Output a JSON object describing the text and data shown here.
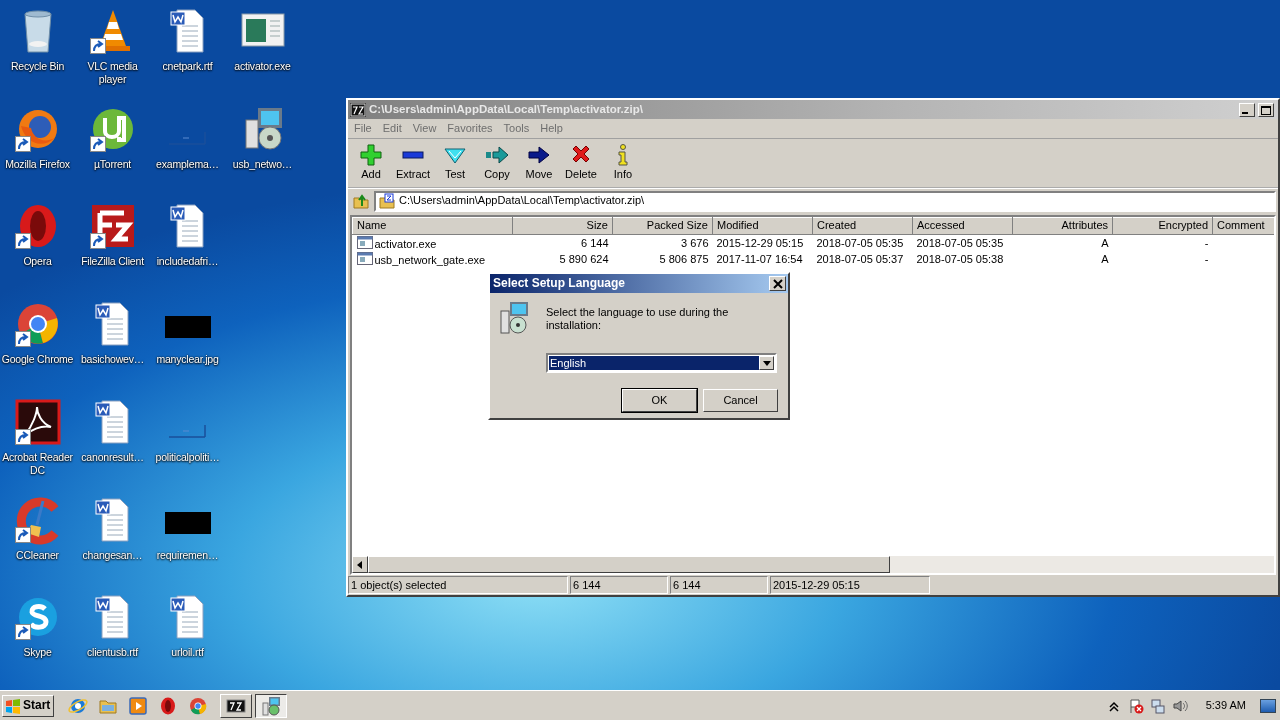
{
  "desktop": {
    "columns": [
      [
        {
          "label": "Recycle Bin",
          "kind": "recycle",
          "shortcut": false
        },
        {
          "label": "Mozilla Firefox",
          "kind": "firefox",
          "shortcut": true
        },
        {
          "label": "Opera",
          "kind": "opera",
          "shortcut": true
        },
        {
          "label": "Google Chrome",
          "kind": "chrome",
          "shortcut": true
        },
        {
          "label": "Acrobat Reader DC",
          "kind": "acrobat",
          "shortcut": true
        },
        {
          "label": "CCleaner",
          "kind": "ccleaner",
          "shortcut": true
        },
        {
          "label": "Skype",
          "kind": "skype",
          "shortcut": true
        }
      ],
      [
        {
          "label": "VLC media player",
          "kind": "vlc",
          "shortcut": true
        },
        {
          "label": "µTorrent",
          "kind": "utorrent",
          "shortcut": true
        },
        {
          "label": "FileZilla Client",
          "kind": "filezilla",
          "shortcut": true
        },
        {
          "label": "basichowev…",
          "kind": "word",
          "shortcut": false
        },
        {
          "label": "canonresult…",
          "kind": "word",
          "shortcut": false
        },
        {
          "label": "changesan…",
          "kind": "word",
          "shortcut": false
        },
        {
          "label": "clientusb.rtf",
          "kind": "word",
          "shortcut": false
        }
      ],
      [
        {
          "label": "cnetpark.rtf",
          "kind": "word",
          "shortcut": false
        },
        {
          "label": "examplema…",
          "kind": "blank",
          "shortcut": false
        },
        {
          "label": "includedafri…",
          "kind": "word",
          "shortcut": false
        },
        {
          "label": "manyclear.jpg",
          "kind": "image",
          "shortcut": false
        },
        {
          "label": "politicalpoliti…",
          "kind": "blank",
          "shortcut": false
        },
        {
          "label": "requiremen…",
          "kind": "image",
          "shortcut": false
        },
        {
          "label": "urloil.rtf",
          "kind": "word",
          "shortcut": false
        }
      ],
      [
        {
          "label": "activator.exe",
          "kind": "exe",
          "shortcut": false
        },
        {
          "label": "usb_netwo…",
          "kind": "setup",
          "shortcut": false
        }
      ]
    ]
  },
  "archiver": {
    "title": "C:\\Users\\admin\\AppData\\Local\\Temp\\activator.zip\\",
    "menu": [
      "File",
      "Edit",
      "View",
      "Favorites",
      "Tools",
      "Help"
    ],
    "toolbar": [
      {
        "label": "Add",
        "kind": "add"
      },
      {
        "label": "Extract",
        "kind": "extract"
      },
      {
        "label": "Test",
        "kind": "test"
      },
      {
        "label": "Copy",
        "kind": "copy"
      },
      {
        "label": "Move",
        "kind": "move"
      },
      {
        "label": "Delete",
        "kind": "delete"
      },
      {
        "label": "Info",
        "kind": "info"
      }
    ],
    "path": "C:\\Users\\admin\\AppData\\Local\\Temp\\activator.zip\\",
    "columns": [
      "Name",
      "Size",
      "Packed Size",
      "Modified",
      "Created",
      "Accessed",
      "Attributes",
      "Encrypted",
      "Comment"
    ],
    "rows": [
      [
        "activator.exe",
        "6 144",
        "3 676",
        "2015-12-29 05:15",
        "2018-07-05 05:35",
        "2018-07-05 05:35",
        "A",
        "-"
      ],
      [
        "usb_network_gate.exe",
        "5 890 624",
        "5 806 875",
        "2017-11-07 16:54",
        "2018-07-05 05:37",
        "2018-07-05 05:38",
        "A",
        "-"
      ]
    ],
    "status_bar": [
      "1 object(s) selected",
      "6 144",
      "6 144",
      "2015-12-29 05:15"
    ]
  },
  "dialog": {
    "title": "Select Setup Language",
    "message": "Select the language to use during the installation:",
    "language": "English",
    "buttons": [
      {
        "label": "OK",
        "default": true
      },
      {
        "label": "Cancel",
        "default": false
      }
    ]
  },
  "taskbar": {
    "start": "Start",
    "pinned": [
      {
        "kind": "ie"
      },
      {
        "kind": "explorer"
      },
      {
        "kind": "media"
      },
      {
        "kind": "opera"
      },
      {
        "kind": "chrome"
      }
    ],
    "windows": [
      {
        "kind": "sevenzip",
        "selected": false
      },
      {
        "kind": "setup",
        "selected": true
      }
    ],
    "tray": [
      {
        "kind": "chevron"
      },
      {
        "kind": "flag"
      },
      {
        "kind": "network"
      },
      {
        "kind": "speaker"
      }
    ],
    "clock": "5:39 AM"
  }
}
